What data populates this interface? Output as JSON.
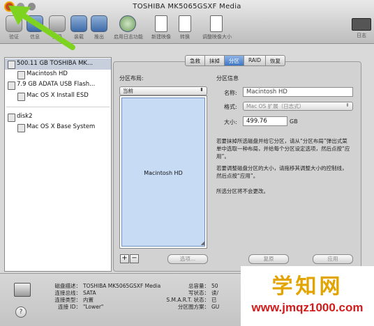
{
  "window": {
    "title": "TOSHIBA MK5065GSXF Media"
  },
  "toolbar": {
    "items": [
      {
        "label": "验证"
      },
      {
        "label": "信息"
      },
      {
        "label": "刻录"
      },
      {
        "label": "装载"
      },
      {
        "label": "推出"
      },
      {
        "label": "启用日志功能"
      },
      {
        "label": "新建映像"
      },
      {
        "label": "转换"
      },
      {
        "label": "调整映像大小"
      }
    ],
    "log_label": "日志"
  },
  "sidebar": {
    "items": [
      {
        "label": "500.11 GB TOSHIBA MK...",
        "indent": 0,
        "selected": true
      },
      {
        "label": "Macintosh HD",
        "indent": 1,
        "selected": false
      },
      {
        "label": "7.9 GB ADATA USB Flash...",
        "indent": 0,
        "selected": false
      },
      {
        "label": "Mac OS X Install ESD",
        "indent": 1,
        "selected": false
      },
      {
        "label": "disk2",
        "indent": 0,
        "selected": false
      },
      {
        "label": "Mac OS X Base System",
        "indent": 1,
        "selected": false
      }
    ]
  },
  "tabs": [
    {
      "label": "急救",
      "active": false
    },
    {
      "label": "抹掉",
      "active": false
    },
    {
      "label": "分区",
      "active": true
    },
    {
      "label": "RAID",
      "active": false
    },
    {
      "label": "恢复",
      "active": false
    }
  ],
  "partition": {
    "layout_title": "分区布局:",
    "layout_select": "当前",
    "partition_name": "Macintosh HD",
    "info_title": "分区信息",
    "name_label": "名称:",
    "name_value": "Macintosh HD",
    "format_label": "格式:",
    "format_value": "Mac OS 扩展（日志式）",
    "size_label": "大小:",
    "size_value": "499.76",
    "size_unit": "GB",
    "help1": "若要抹掉所选磁盘并给它分区，请从“分区布局”弹出式菜单中选取一种布局，并给每个分区设定选项，然后点按“应用”。",
    "help2": "若要调整磁盘分区的大小，请拖移其调整大小的控制线，然后点按“应用”。",
    "help3": "所选分区将不会更改。",
    "plus": "+",
    "minus": "−",
    "options_button": "选项...",
    "revert_button": "复原",
    "apply_button": "应用"
  },
  "footer": {
    "left": [
      {
        "label": "磁盘描述：",
        "value": "TOSHIBA MK5065GSXF Media"
      },
      {
        "label": "连接总线：",
        "value": "SATA"
      },
      {
        "label": "连接类型：",
        "value": "内置"
      },
      {
        "label": "连接 ID：",
        "value": "\"Lower\""
      }
    ],
    "right": [
      {
        "label": "总容量：",
        "value": "50"
      },
      {
        "label": "写状态：",
        "value": "读/"
      },
      {
        "label": "S.M.A.R.T. 状态：",
        "value": "已"
      },
      {
        "label": "分区图方案：",
        "value": "GU"
      }
    ],
    "help_glyph": "?"
  },
  "watermark": {
    "text": "学知网",
    "url": "www.jmqz1000.com"
  },
  "colors": {
    "arrow": "#7ed321",
    "selection": "#c6cfdb",
    "accent": "#3f77c5",
    "watermark_text": "#e2a400",
    "watermark_url": "#d21c1c"
  }
}
